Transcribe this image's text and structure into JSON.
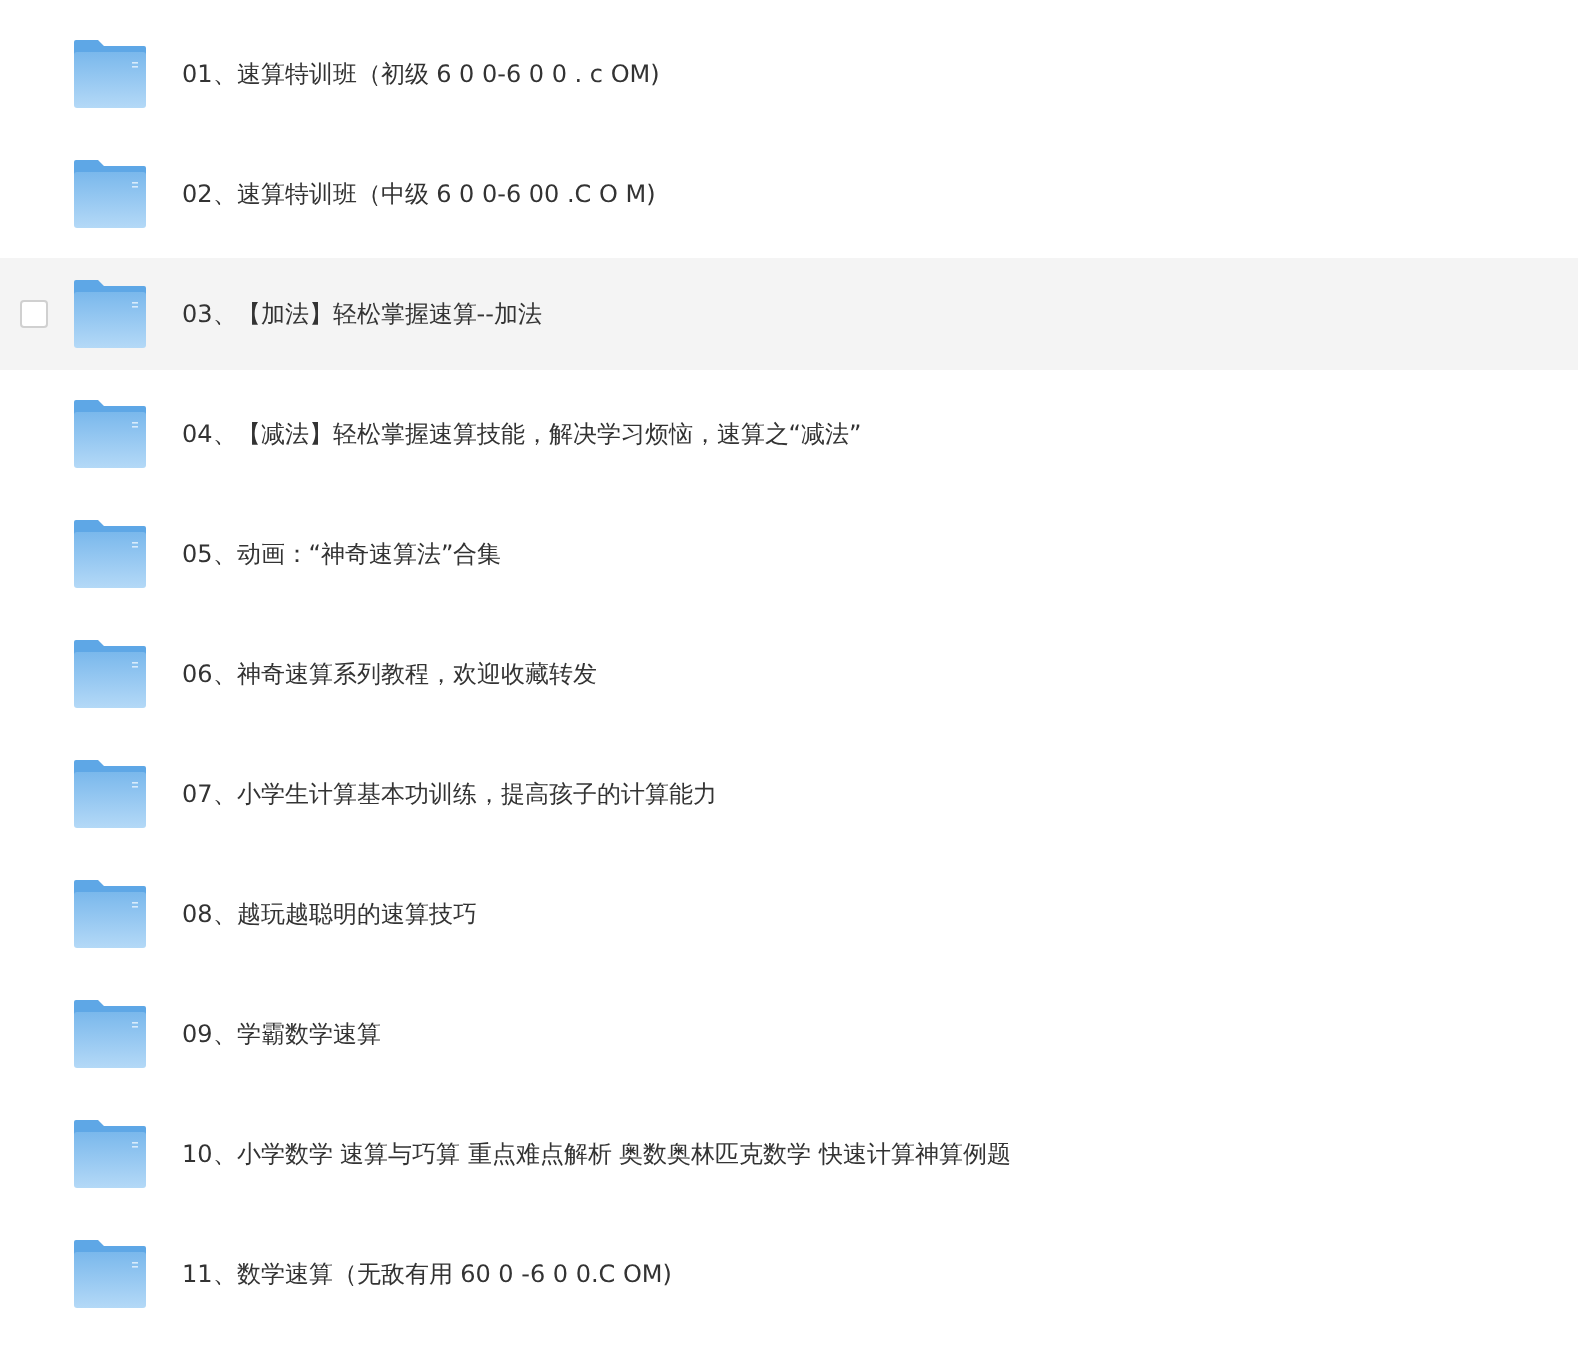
{
  "folders": [
    {
      "name": "01、速算特训班（初级 6 0 0-6 0 0 . c OM)",
      "highlighted": false
    },
    {
      "name": "02、速算特训班（中级 6 0 0-6 00 .C O M)",
      "highlighted": false
    },
    {
      "name": "03、【加法】轻松掌握速算--加法",
      "highlighted": true
    },
    {
      "name": "04、【减法】轻松掌握速算技能，解决学习烦恼，速算之“减法”",
      "highlighted": false
    },
    {
      "name": "05、动画：“神奇速算法”合集",
      "highlighted": false
    },
    {
      "name": "06、神奇速算系列教程，欢迎收藏转发",
      "highlighted": false
    },
    {
      "name": "07、小学生计算基本功训练，提高孩子的计算能力",
      "highlighted": false
    },
    {
      "name": "08、越玩越聪明的速算技巧",
      "highlighted": false
    },
    {
      "name": "09、学霸数学速算",
      "highlighted": false
    },
    {
      "name": "10、小学数学 速算与巧算 重点难点解析 奥数奥林匹克数学 快速计算神算例题",
      "highlighted": false
    },
    {
      "name": "11、数学速算（无敌有用 60 0 -6 0 0.C OM)",
      "highlighted": false
    }
  ]
}
